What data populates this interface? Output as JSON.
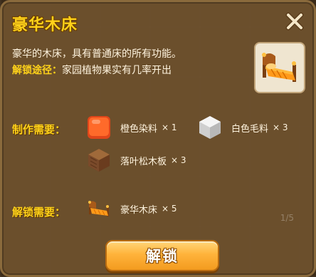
{
  "dialog": {
    "title": "豪华木床",
    "description": "豪华的木床，具有普通床的所有功能。",
    "unlock_path_label": "解锁途径：",
    "unlock_path_value": "家园植物果实有几率开出",
    "preview_icon": "luxury-wooden-bed-icon"
  },
  "crafting": {
    "label": "制作需要：",
    "materials": [
      {
        "name": "橙色染料",
        "qty": "× 1",
        "icon": "orange-dye-icon",
        "color": "#ff6a2a"
      },
      {
        "name": "白色毛料",
        "qty": "× 3",
        "icon": "white-wool-icon",
        "color": "#e8e8e8"
      },
      {
        "name": "落叶松木板",
        "qty": "× 3",
        "icon": "larch-plank-icon",
        "color": "#7a4a2a"
      }
    ]
  },
  "unlock": {
    "label": "解锁需要：",
    "item": {
      "name": "豪华木床",
      "qty": "× 5",
      "icon": "luxury-wooden-bed-icon"
    }
  },
  "page_indicator": "1/5",
  "button": {
    "label": "解锁"
  },
  "colors": {
    "title": "#ffd21a",
    "panel": "#6f522e",
    "button": "#ffb33b"
  }
}
